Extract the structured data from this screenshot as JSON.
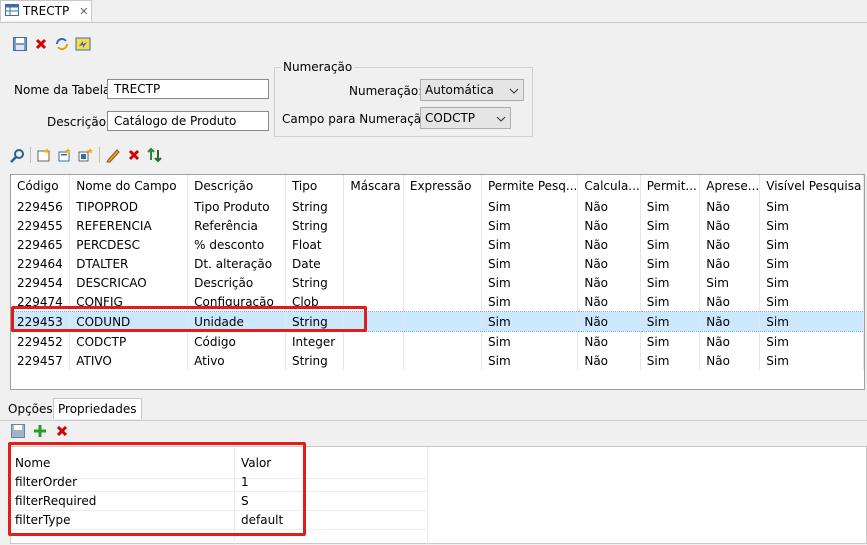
{
  "tab": {
    "title": "TRECTP",
    "close": "✕"
  },
  "form": {
    "nome_tabela_label": "Nome da Tabela:",
    "nome_tabela_value": "TRECTP",
    "descricao_label": "Descrição:",
    "descricao_value": "Catálogo de Produto",
    "numeracao_group": "Numeração",
    "numeracao_label": "Numeração:",
    "numeracao_value": "Automática",
    "campo_label": "Campo para Numeração:",
    "campo_value": "CODCTP"
  },
  "grid": {
    "columns": [
      "Código",
      "Nome do Campo",
      "Descrição",
      "Tipo",
      "Máscara",
      "Expressão",
      "Permite Pesq...",
      "Calcula...",
      "Permit...",
      "Aprese...",
      "Visível Pesquisa"
    ],
    "rows": [
      [
        "229456",
        "TIPOPROD",
        "Tipo Produto",
        "String",
        "",
        "",
        "Sim",
        "Não",
        "Sim",
        "Não",
        "Sim"
      ],
      [
        "229455",
        "REFERENCIA",
        "Referência",
        "String",
        "",
        "",
        "Sim",
        "Não",
        "Sim",
        "Não",
        "Sim"
      ],
      [
        "229465",
        "PERCDESC",
        "% desconto",
        "Float",
        "",
        "",
        "Sim",
        "Não",
        "Sim",
        "Não",
        "Sim"
      ],
      [
        "229464",
        "DTALTER",
        "Dt. alteração",
        "Date",
        "",
        "",
        "Sim",
        "Não",
        "Sim",
        "Não",
        "Sim"
      ],
      [
        "229454",
        "DESCRICAO",
        "Descrição",
        "String",
        "",
        "",
        "Sim",
        "Não",
        "Sim",
        "Sim",
        "Sim"
      ],
      [
        "229474",
        "CONFIG",
        "Configuração",
        "Clob",
        "",
        "",
        "Sim",
        "Não",
        "Sim",
        "Não",
        "Sim"
      ],
      [
        "229453",
        "CODUND",
        "Unidade",
        "String",
        "",
        "",
        "Sim",
        "Não",
        "Sim",
        "Não",
        "Sim"
      ],
      [
        "229452",
        "CODCTP",
        "Código",
        "Integer",
        "",
        "",
        "Sim",
        "Não",
        "Sim",
        "Não",
        "Sim"
      ],
      [
        "229457",
        "ATIVO",
        "Ativo",
        "String",
        "",
        "",
        "Sim",
        "Não",
        "Sim",
        "Não",
        "Sim"
      ]
    ],
    "selected_row": 6
  },
  "bottom_tabs": {
    "opcoes": "Opções",
    "propriedades": "Propriedades"
  },
  "props": {
    "header_nome": "Nome",
    "header_valor": "Valor",
    "rows": [
      {
        "nome": "filterOrder",
        "valor": "1"
      },
      {
        "nome": "filterRequired",
        "valor": "S"
      },
      {
        "nome": "filterType",
        "valor": "default"
      }
    ]
  },
  "colors": {
    "highlight": "#e21b1b",
    "selected_row": "#cce8ff"
  }
}
